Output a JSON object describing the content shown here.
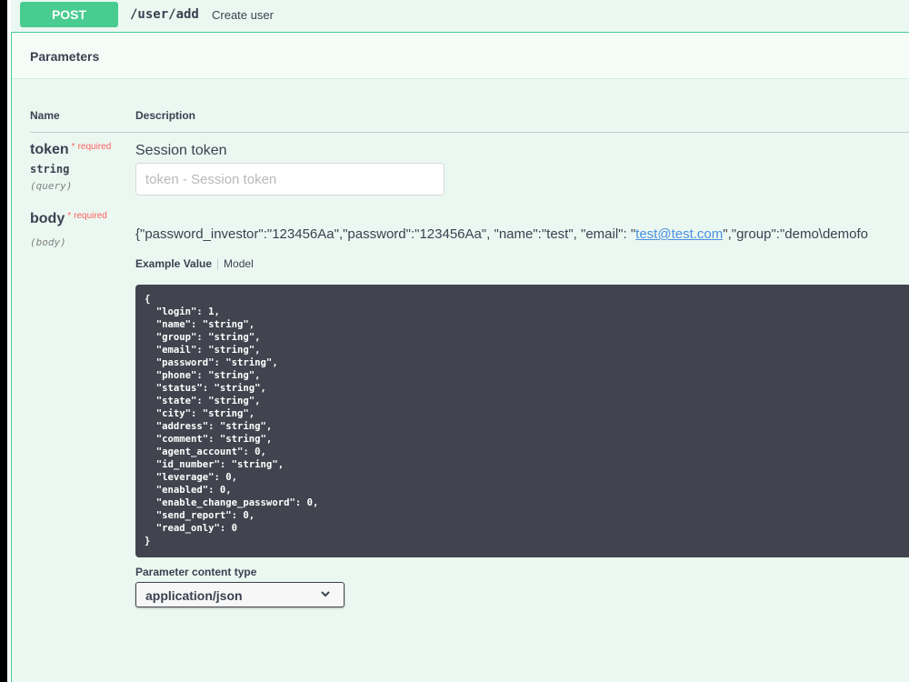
{
  "operation": {
    "method": "POST",
    "path": "/user/add",
    "summary": "Create user"
  },
  "parameters": {
    "title": "Parameters",
    "col_name": "Name",
    "col_description": "Description",
    "items": [
      {
        "name": "token",
        "required_mark": "*",
        "required_text": "required",
        "type": "string",
        "in": "(query)",
        "description": "Session token",
        "placeholder": "token - Session token"
      },
      {
        "name": "body",
        "required_mark": "*",
        "required_text": "required",
        "in": "(body)",
        "value_prefix": "{\"password_investor\":\"123456Aa\",\"password\":\"123456Aa\", \"name\":\"test\", \"email\": \"",
        "value_link": "test@test.com",
        "value_suffix": "\",\"group\":\"demo\\demofo"
      }
    ]
  },
  "example": {
    "tab_active": "Example Value",
    "tab_inactive": "Model",
    "code": "{\n  \"login\": 1,\n  \"name\": \"string\",\n  \"group\": \"string\",\n  \"email\": \"string\",\n  \"password\": \"string\",\n  \"phone\": \"string\",\n  \"status\": \"string\",\n  \"state\": \"string\",\n  \"city\": \"string\",\n  \"address\": \"string\",\n  \"comment\": \"string\",\n  \"agent_account\": 0,\n  \"id_number\": \"string\",\n  \"leverage\": 0,\n  \"enabled\": 0,\n  \"enable_change_password\": 0,\n  \"send_report\": 0,\n  \"read_only\": 0\n}"
  },
  "content_type": {
    "label": "Parameter content type",
    "selected": "application/json"
  },
  "colors": {
    "post_green": "#49cc90",
    "post_bg": "#ebf8f1",
    "required_red": "#ff6060",
    "code_bg": "#41444e",
    "link_blue": "#4990e2"
  },
  "icons": {
    "select": "chevron-down-icon"
  }
}
